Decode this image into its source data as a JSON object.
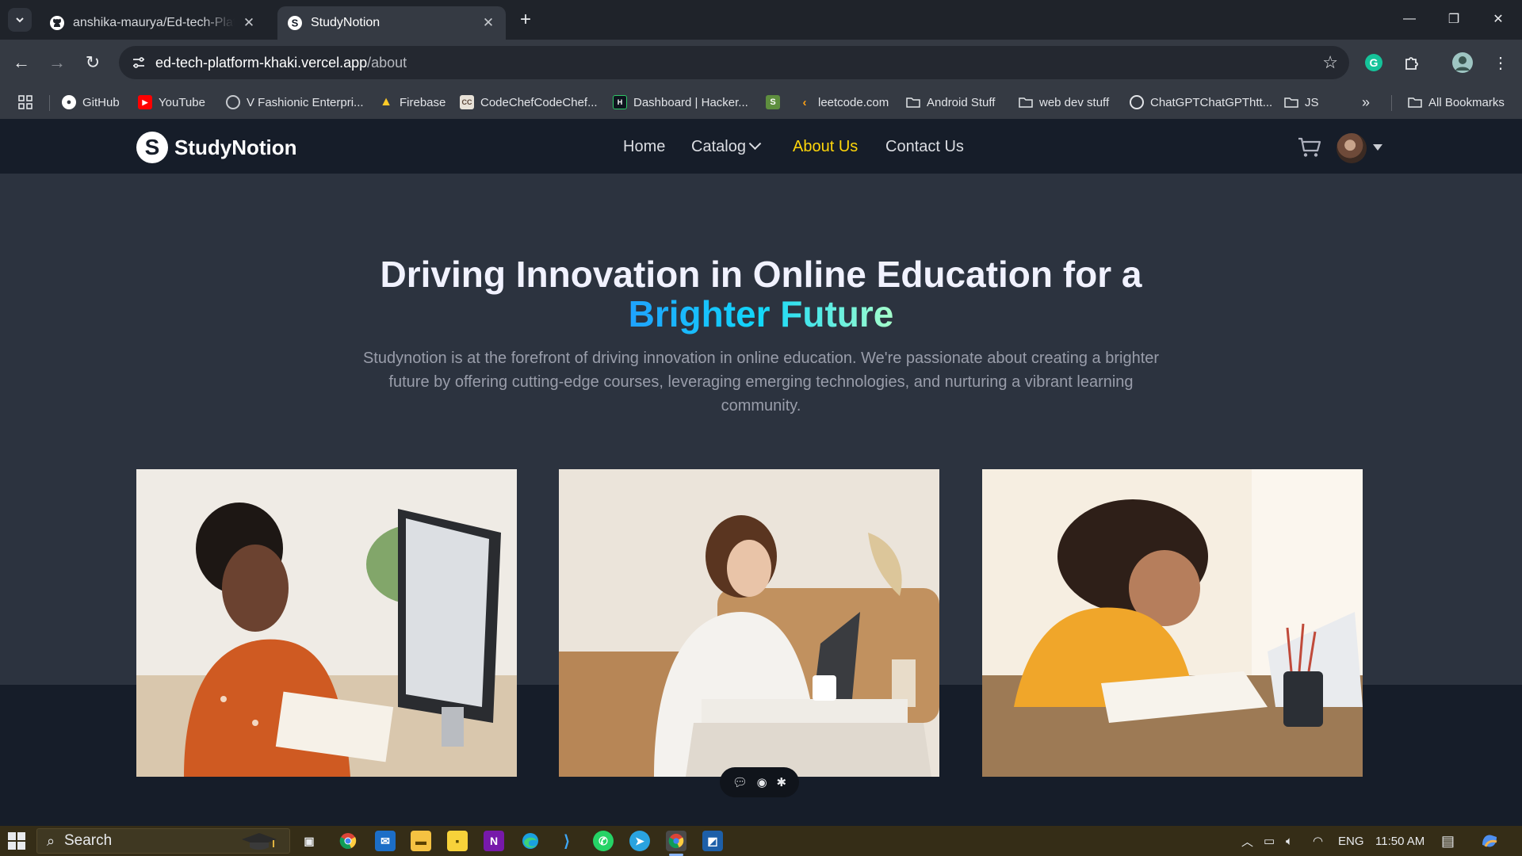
{
  "browser": {
    "tabs": [
      {
        "title": "anshika-maurya/Ed-tech-Platform",
        "favicon": "github-icon",
        "active": false
      },
      {
        "title": "StudyNotion",
        "favicon": "studynotion-icon",
        "active": true
      }
    ],
    "address": {
      "host": "ed-tech-platform-khaki.vercel.app",
      "path": "/about"
    },
    "bookmarks": [
      {
        "label": "GitHub",
        "icon": "github-icon"
      },
      {
        "label": "YouTube",
        "icon": "youtube-icon"
      },
      {
        "label": "V Fashionic Enterpri...",
        "icon": "globe-icon"
      },
      {
        "label": "Firebase",
        "icon": "firebase-icon"
      },
      {
        "label": "CodeChefCodeChef...",
        "icon": "codechef-icon"
      },
      {
        "label": "Dashboard | Hacker...",
        "icon": "hackerrank-icon"
      },
      {
        "label": "leetcode.com",
        "icon": "leetcode-icon"
      },
      {
        "label": "Android Stuff",
        "icon": "folder-icon"
      },
      {
        "label": "web dev stuff",
        "icon": "folder-icon"
      },
      {
        "label": "ChatGPTChatGPThtt...",
        "icon": "chatgpt-icon"
      },
      {
        "label": "JS",
        "icon": "folder-icon"
      }
    ],
    "all_bookmarks": "All Bookmarks"
  },
  "site": {
    "brand": "StudyNotion",
    "nav": [
      {
        "label": "Home",
        "active": false
      },
      {
        "label": "Catalog",
        "active": false
      },
      {
        "label": "About Us",
        "active": true
      },
      {
        "label": "Contact Us",
        "active": false
      }
    ]
  },
  "hero": {
    "title": "Driving Innovation in Online Education for a",
    "highlight": "Brighter Future",
    "description": "Studynotion is at the forefront of driving innovation in online education. We're passionate about creating a brighter future by offering cutting-edge courses, leveraging emerging technologies, and nurturing a vibrant learning community."
  },
  "taskbar": {
    "search_label": "Search",
    "language": "ENG",
    "time": "11:50 AM"
  },
  "colors": {
    "accent_yellow": "#ffd60a",
    "gradient": [
      "#1fa2ff",
      "#12d8fa",
      "#a6ffcb"
    ],
    "hero_bg": "#2c333f",
    "page_bg": "#161d29"
  }
}
